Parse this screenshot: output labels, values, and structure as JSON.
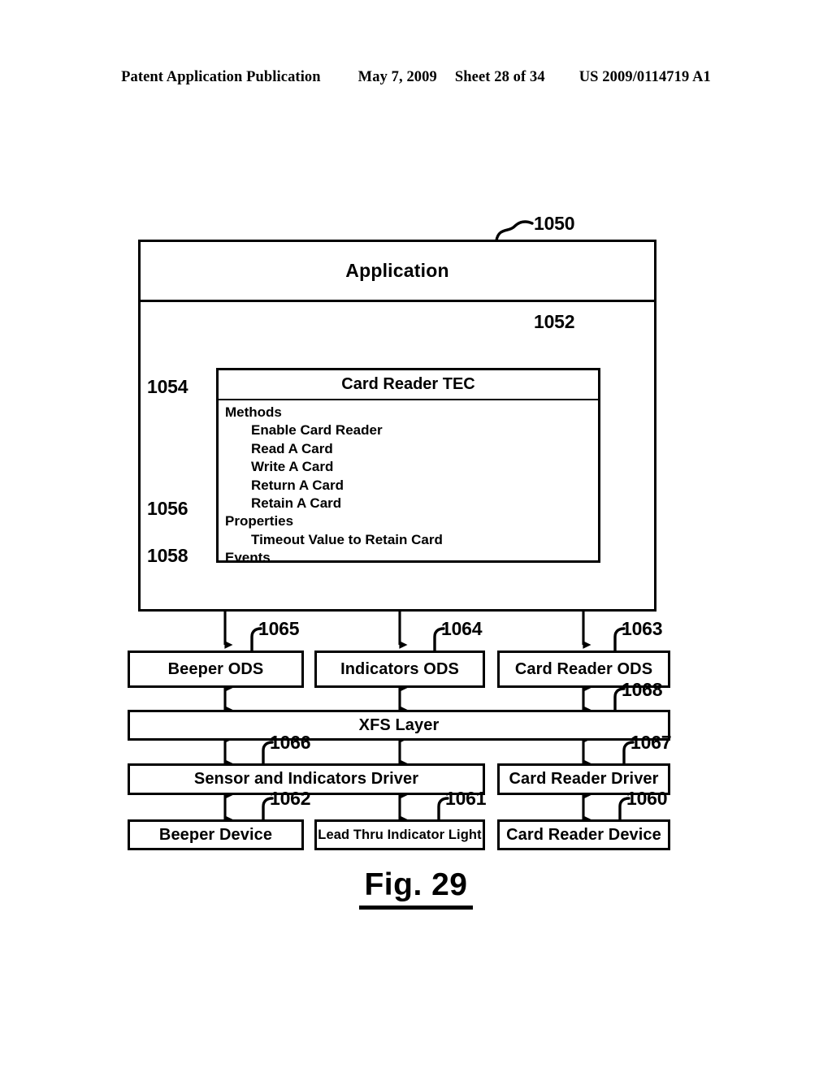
{
  "header": {
    "publication": "Patent Application Publication",
    "date": "May 7, 2009",
    "sheet": "Sheet 28 of 34",
    "patent_number": "US 2009/0114719 A1"
  },
  "figure": {
    "caption": "Fig. 29"
  },
  "diagram": {
    "application": {
      "label": "Application",
      "ref": "1050"
    },
    "tec": {
      "title": "Card Reader TEC",
      "ref": "1052",
      "sections": [
        {
          "heading": "Methods",
          "ref": "1054",
          "items": [
            "Enable Card Reader",
            "Read A Card",
            "Write A Card",
            "Return A Card",
            "Retain A Card"
          ]
        },
        {
          "heading": "Properties",
          "ref": "1056",
          "items": [
            "Timeout Value to Retain Card"
          ]
        },
        {
          "heading": "Events",
          "ref": "1058",
          "items": []
        }
      ]
    },
    "ods_row": [
      {
        "label": "Beeper ODS",
        "ref": "1065"
      },
      {
        "label": "Indicators ODS",
        "ref": "1064"
      },
      {
        "label": "Card Reader ODS",
        "ref": "1063"
      }
    ],
    "xfs_layer": {
      "label": "XFS Layer",
      "ref": "1068"
    },
    "driver_row": [
      {
        "label": "Sensor and Indicators Driver",
        "ref": "1066"
      },
      {
        "label": "Card Reader Driver",
        "ref": "1067"
      }
    ],
    "device_row": [
      {
        "label": "Beeper Device",
        "ref": "1062"
      },
      {
        "label": "Lead Thru Indicator Light",
        "ref": "1061"
      },
      {
        "label": "Card Reader Device",
        "ref": "1060"
      }
    ]
  },
  "colors": {
    "ink": "#000000",
    "paper": "#ffffff"
  }
}
